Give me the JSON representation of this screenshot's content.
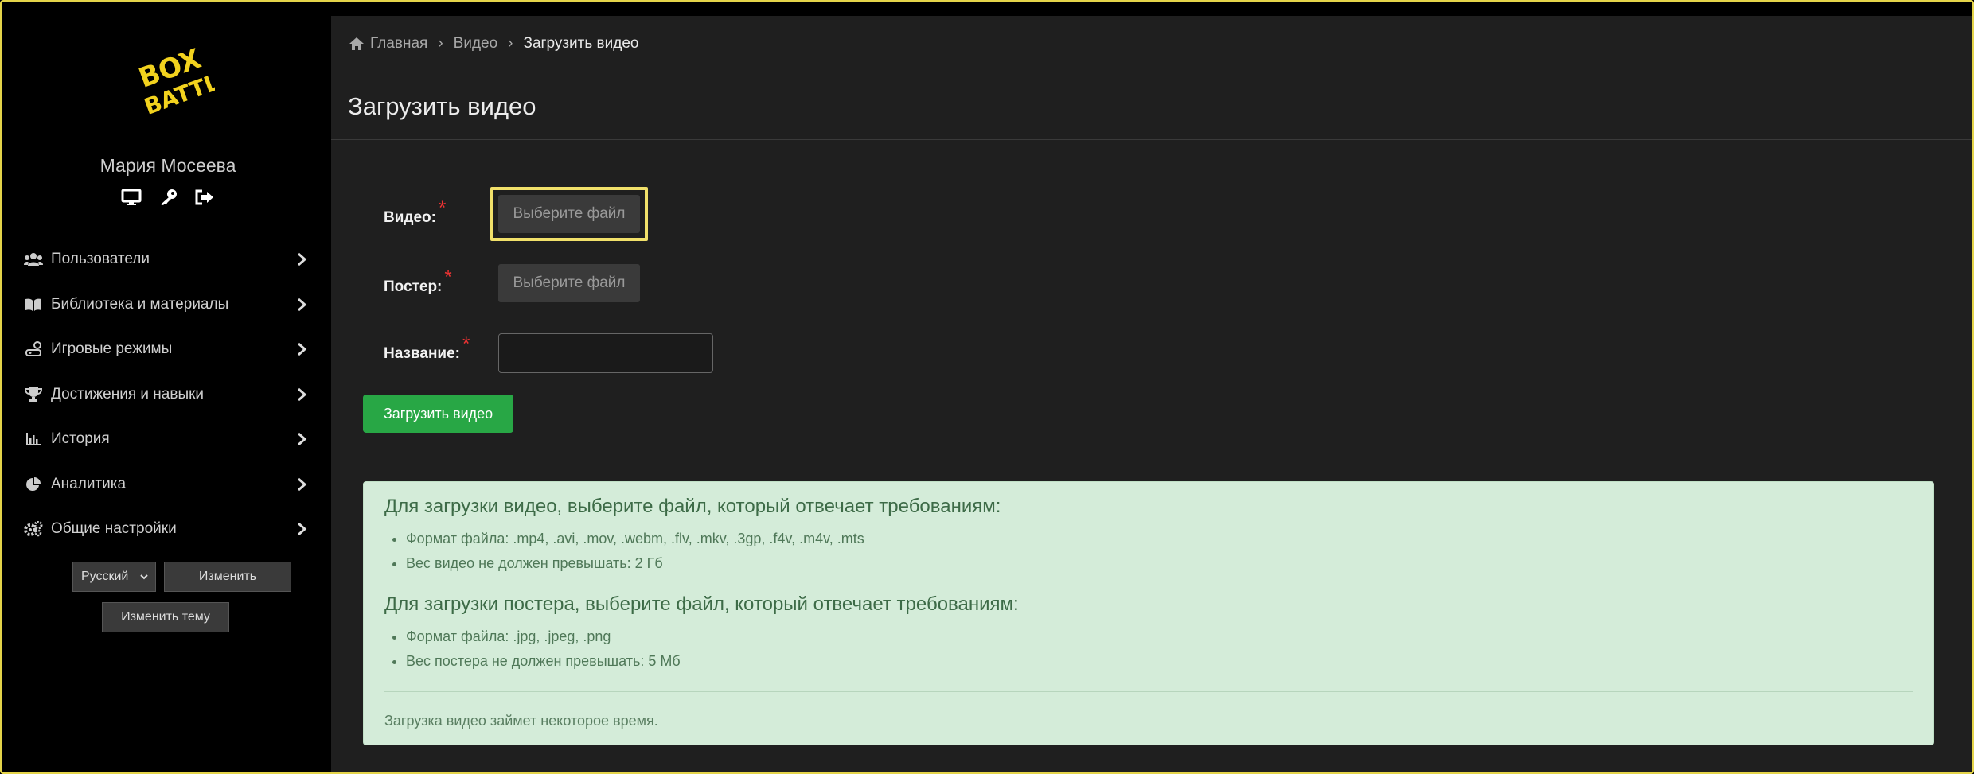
{
  "sidebar": {
    "logo_alt": "Box Battle",
    "user_name": "Мария Мосеева",
    "user_icons": [
      "monitor-icon",
      "key-icon",
      "sign-out-icon"
    ],
    "items": [
      {
        "label": "Пользователи",
        "icon": "users-icon"
      },
      {
        "label": "Библиотека и материалы",
        "icon": "book-icon"
      },
      {
        "label": "Игровые режимы",
        "icon": "game-icon"
      },
      {
        "label": "Достижения и навыки",
        "icon": "trophy-icon"
      },
      {
        "label": "История",
        "icon": "chart-icon"
      },
      {
        "label": "Аналитика",
        "icon": "pie-icon"
      },
      {
        "label": "Общие настройки",
        "icon": "gears-icon"
      }
    ],
    "language": "Русский",
    "change_button": "Изменить",
    "theme_button": "Изменить тему"
  },
  "breadcrumb": {
    "home": "Главная",
    "video": "Видео",
    "current": "Загрузить видео"
  },
  "page": {
    "title": "Загрузить видео"
  },
  "form": {
    "video_label": "Видео:",
    "poster_label": "Постер:",
    "name_label": "Название:",
    "required_mark": "*",
    "file_button": "Выберите файл",
    "name_value": "",
    "submit": "Загрузить видео"
  },
  "info": {
    "video_heading": "Для загрузки видео, выберите файл, который отвечает требованиям:",
    "video_rules": [
      "Формат файла: .mp4, .avi, .mov, .webm, .flv, .mkv, .3gp, .f4v, .m4v, .mts",
      "Вес видео не должен превышать: 2 Гб"
    ],
    "poster_heading": "Для загрузки постера, выберите файл, который отвечает требованиям:",
    "poster_rules": [
      "Формат файла: .jpg, .jpeg, .png",
      "Вес постера не должен превышать: 5 Мб"
    ],
    "note": "Загрузка видео займет некоторое время."
  },
  "colors": {
    "accent": "#f1e06a",
    "success": "#28a745",
    "info_bg": "#d4ecd9",
    "required": "#e33"
  }
}
